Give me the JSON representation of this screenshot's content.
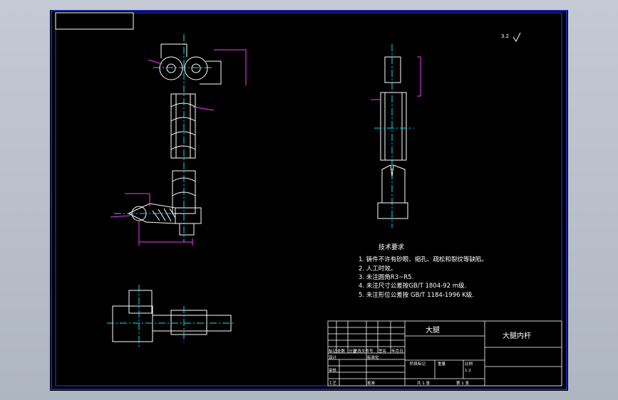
{
  "colors": {
    "background": "#000000",
    "frame": "#2e3dff",
    "outline": "#ffffff",
    "centerline": "#00e5ff",
    "dimension": "#ff33ff",
    "hatch": "#ffffff"
  },
  "roughness_symbol": "3.2",
  "technical_requirements": {
    "title": "技术要求",
    "items": [
      "1. 铸件不许有砂眼、缩孔、疏松和裂纹等缺陷。",
      "2. 人工时效。",
      "3. 未注圆角R3~R5.",
      "4. 未注尺寸公差按GB/T 1804-92 m级.",
      "5. 未注形位公差按 GB/T 1184-1996 K级."
    ]
  },
  "title_block": {
    "assembly_name": "大腿",
    "part_name": "大腿内杆",
    "scale": "1:2",
    "sheet_info": "共 1 张",
    "sheet_number": "第 1 张",
    "row_labels": [
      "标记",
      "处数",
      "分区",
      "更改文件号",
      "签名",
      "年月日"
    ],
    "role_labels": [
      "设计",
      "审核",
      "工艺",
      "标准化",
      "批准"
    ],
    "col_labels": [
      "阶段标记",
      "重量",
      "比例"
    ]
  }
}
